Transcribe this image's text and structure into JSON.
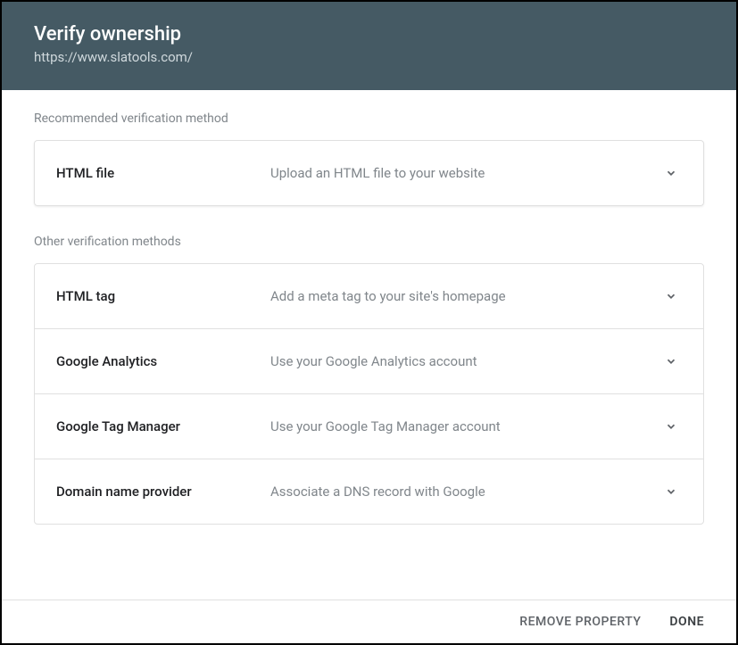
{
  "header": {
    "title": "Verify ownership",
    "subtitle": "https://www.slatools.com/"
  },
  "sections": {
    "recommended_label": "Recommended verification method",
    "other_label": "Other verification methods"
  },
  "recommended": {
    "title": "HTML file",
    "desc": "Upload an HTML file to your website"
  },
  "methods": [
    {
      "title": "HTML tag",
      "desc": "Add a meta tag to your site's homepage"
    },
    {
      "title": "Google Analytics",
      "desc": "Use your Google Analytics account"
    },
    {
      "title": "Google Tag Manager",
      "desc": "Use your Google Tag Manager account"
    },
    {
      "title": "Domain name provider",
      "desc": "Associate a DNS record with Google"
    }
  ],
  "footer": {
    "remove": "REMOVE PROPERTY",
    "done": "DONE"
  }
}
